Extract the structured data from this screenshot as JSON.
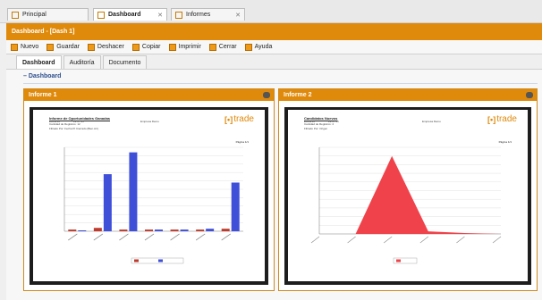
{
  "top_tabs": [
    {
      "label": "Principal",
      "closable": false,
      "active": false
    },
    {
      "label": "Dashboard",
      "closable": true,
      "active": true
    },
    {
      "label": "Informes",
      "closable": true,
      "active": false
    }
  ],
  "window_title": "Dashboard - [Dash 1]",
  "toolbar": [
    "Nuevo",
    "Guardar",
    "Deshacer",
    "Copiar",
    "Imprimir",
    "Cerrar",
    "Ayuda"
  ],
  "sub_tabs": [
    "Dashboard",
    "Auditoría",
    "Documento"
  ],
  "section_title": "Dashboard",
  "accent_color": "#e08a0b",
  "panels": [
    {
      "title": "Informe 1",
      "report": {
        "title": "Informe de Oportunidades Ganadas",
        "lines": [
          "Cantidad de Registros: 12",
          "Filtrado Por: Fecha Pt Cierrado (Bien Arr)"
        ],
        "dates": [
          "28/06/14",
          "13:17:45",
          "Empresa Demo"
        ],
        "page_label": "Página 1/1",
        "logo_text": "trade"
      },
      "chart_data": {
        "type": "bar",
        "series": [
          {
            "color": "#c0392b",
            "values": [
              2,
              4,
              2,
              2,
              2,
              2,
              3
            ]
          },
          {
            "color": "#3f4fd8",
            "values": [
              0,
              68,
              94,
              2,
              2,
              3,
              58
            ]
          }
        ],
        "ylim": [
          0,
          100
        ],
        "legend_position": "bottom"
      }
    },
    {
      "title": "Informe 2",
      "report": {
        "title": "Candidatos Nuevos",
        "lines": [
          "Cantidad de Registros: 4",
          "Filtrado Por: Origen"
        ],
        "dates": [
          "28/06/14",
          "13:17:45",
          "Empresa Demo"
        ],
        "page_label": "Página 1/1",
        "logo_text": "trade"
      },
      "chart_data": {
        "type": "area",
        "x": [
          0,
          1,
          2,
          3,
          4,
          5
        ],
        "values": [
          0,
          0,
          90,
          3,
          1,
          0
        ],
        "color": "#f0424a",
        "ylim": [
          0,
          100
        ],
        "legend_position": "bottom"
      }
    }
  ]
}
